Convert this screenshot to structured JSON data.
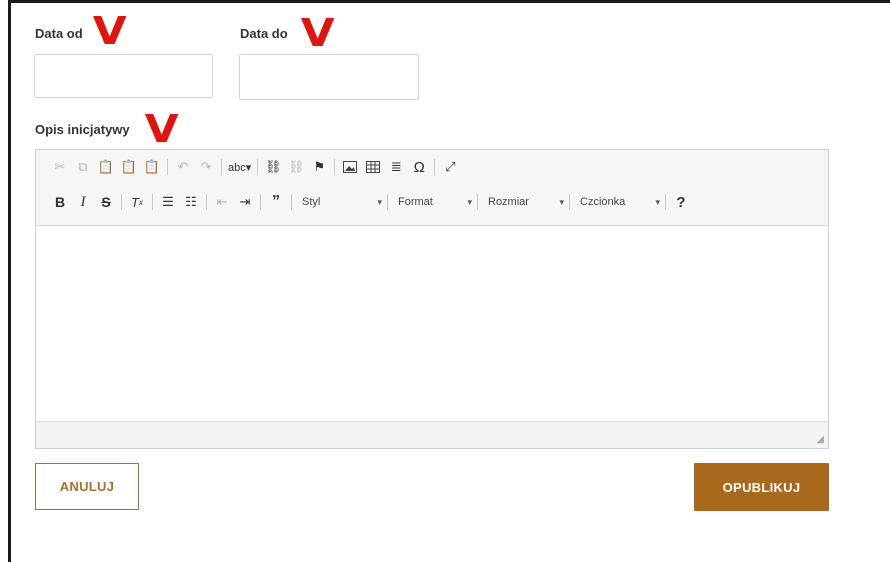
{
  "form": {
    "date_from_label": "Data od",
    "date_from_value": "",
    "date_to_label": "Data do",
    "date_to_value": "",
    "description_label": "Opis inicjatywy",
    "annotation_mark": "V",
    "annotation_color": "#e0130f"
  },
  "editor": {
    "row1_icons": [
      "cut-icon",
      "copy-icon",
      "paste-icon",
      "paste-text-icon",
      "paste-word-icon",
      "undo-icon",
      "redo-icon",
      "spellcheck-icon",
      "link-icon",
      "unlink-icon",
      "anchor-icon",
      "image-icon",
      "table-icon",
      "horizontal-line-icon",
      "special-char-icon",
      "maximize-icon"
    ],
    "row2": {
      "bold": "B",
      "italic": "I",
      "strike": "S",
      "help": "?",
      "style_label": "Styl",
      "format_label": "Format",
      "size_label": "Rozmiar",
      "font_label": "Czcionka"
    },
    "body_text": ""
  },
  "actions": {
    "cancel_label": "ANULUJ",
    "publish_label": "OPUBLIKUJ",
    "accent_color": "#a8691c"
  }
}
